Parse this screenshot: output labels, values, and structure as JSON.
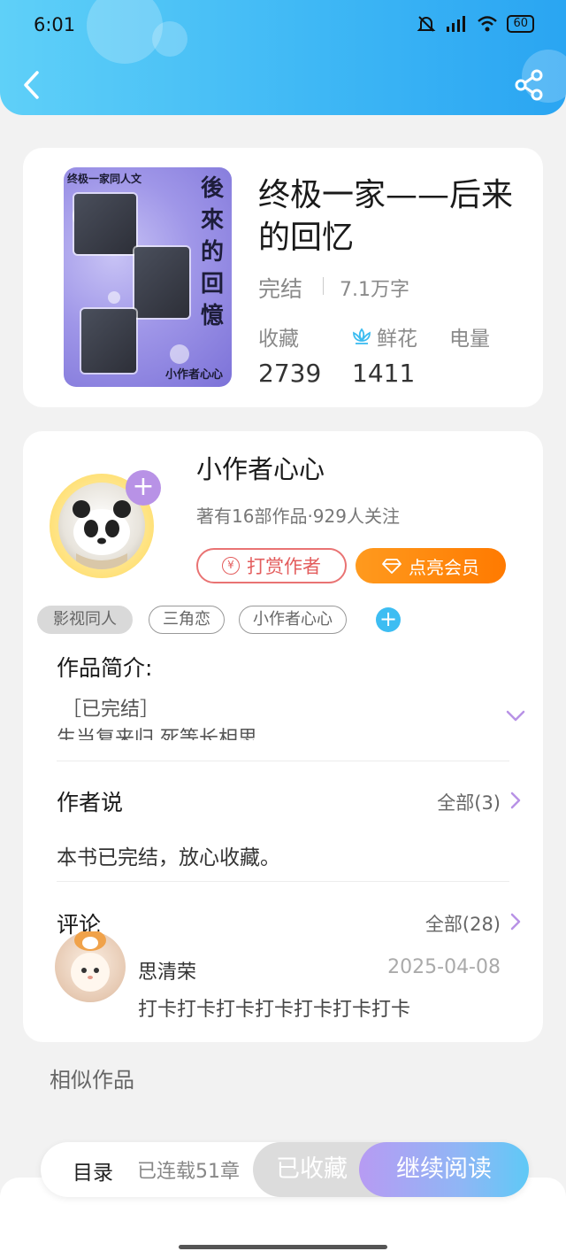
{
  "status_bar": {
    "time": "6:01",
    "battery": "60"
  },
  "book": {
    "title": "终极一家——后来的回忆",
    "status": "完结",
    "words": "7.1万字",
    "cover": {
      "series": "终极一家同人文",
      "title_chars": [
        "後",
        "來",
        "的",
        "回",
        "憶"
      ],
      "author": "小作者心心"
    },
    "stats": [
      {
        "label": "收藏",
        "value": "2739"
      },
      {
        "label": "鲜花",
        "value": "1411",
        "icon": "flower-icon"
      },
      {
        "label": "电量",
        "value": ""
      }
    ]
  },
  "author": {
    "name": "小作者心心",
    "meta": "著有16部作品·929人关注",
    "reward_label": "打赏作者",
    "vip_label": "点亮会员",
    "follow_symbol": "+"
  },
  "tags": [
    "影视同人",
    "三角恋",
    "小作者心心"
  ],
  "intro": {
    "title": "作品简介:",
    "line1": "［已完结］",
    "line2": "生当复来归 死等长相思"
  },
  "author_note": {
    "title": "作者说",
    "more": "全部(3)",
    "text": "本书已完结，放心收藏。"
  },
  "comments": {
    "title": "评论",
    "more": "全部(28)",
    "items": [
      {
        "user": "思清荣",
        "date": "2025-04-08",
        "text": "打卡打卡打卡打卡打卡打卡打卡"
      }
    ]
  },
  "similar_title": "相似作品",
  "bottom": {
    "toc": "目录",
    "serial": "已连载51章",
    "collected": "已收藏",
    "continue": "继续阅读"
  },
  "colors": {
    "header_start": "#5fd0f8",
    "header_end": "#2aa5f2",
    "vip_orange": "#ff8a10",
    "reward_red": "#e35d5d",
    "accent_purple": "#b892e6"
  }
}
